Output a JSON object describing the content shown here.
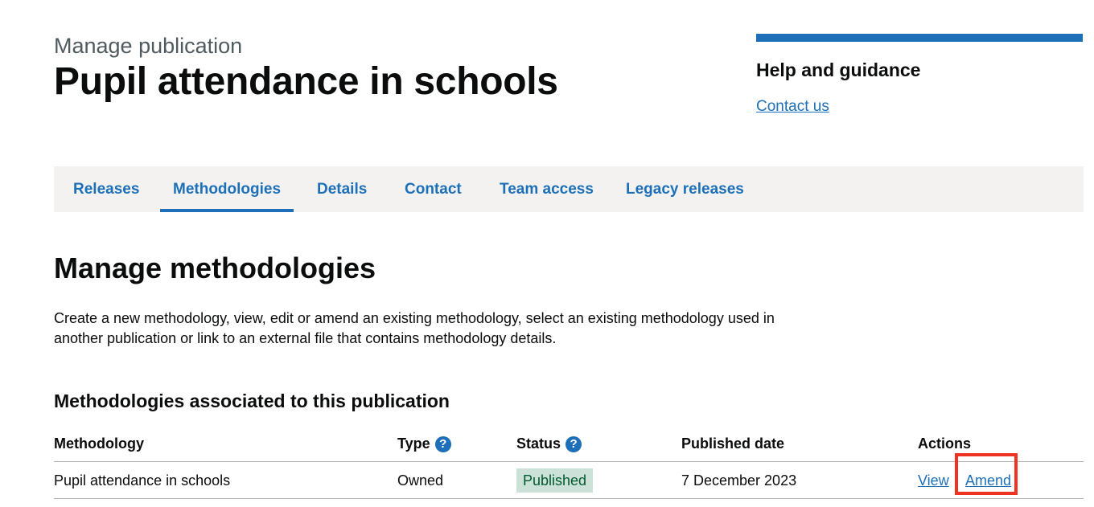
{
  "header": {
    "caption": "Manage publication",
    "title": "Pupil attendance in schools"
  },
  "help": {
    "title": "Help and guidance",
    "contact_link": "Contact us"
  },
  "nav": {
    "items": [
      {
        "label": "Releases"
      },
      {
        "label": "Methodologies",
        "active": true
      },
      {
        "label": "Details"
      },
      {
        "label": "Contact"
      },
      {
        "label": "Team access"
      },
      {
        "label": "Legacy releases"
      }
    ]
  },
  "main": {
    "heading": "Manage methodologies",
    "description": "Create a new methodology, view, edit or amend an existing methodology, select an existing methodology used in another publication or link to an external file that contains methodology details.",
    "subheading": "Methodologies associated to this publication"
  },
  "table": {
    "headers": {
      "methodology": "Methodology",
      "type": "Type",
      "status": "Status",
      "published_date": "Published date",
      "actions": "Actions"
    },
    "help_icon_glyph": "?",
    "rows": [
      {
        "methodology": "Pupil attendance in schools",
        "type": "Owned",
        "status": "Published",
        "published_date": "7 December 2023",
        "view_label": "View",
        "amend_label": "Amend"
      }
    ]
  },
  "colors": {
    "link": "#1d70b8",
    "nav_background": "#f3f2f1",
    "tag_background": "#cce2d8",
    "tag_text": "#005a30",
    "highlight_box": "#ee3322"
  }
}
